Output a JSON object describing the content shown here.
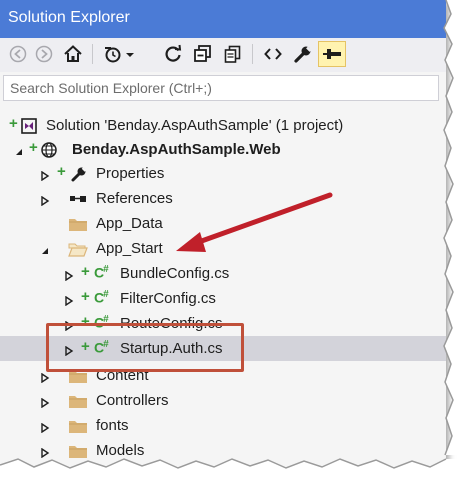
{
  "window": {
    "title": "Solution Explorer"
  },
  "toolbar": {
    "buttons": [
      {
        "icon": "back-icon"
      },
      {
        "icon": "forward-icon"
      },
      {
        "icon": "home-icon"
      },
      {
        "icon": "history-icon"
      },
      {
        "icon": "sync-icon"
      },
      {
        "icon": "collapse-all-icon"
      },
      {
        "icon": "copy-icon"
      },
      {
        "icon": "code-view-icon"
      },
      {
        "icon": "properties-wrench-icon"
      },
      {
        "icon": "pin-icon",
        "active": true
      }
    ]
  },
  "search": {
    "placeholder": "Search Solution Explorer (Ctrl+;)"
  },
  "tree": {
    "items": [
      {
        "label": "Solution 'Benday.AspAuthSample' (1 project)",
        "icon": "solution-icon"
      },
      {
        "label": "Benday.AspAuthSample.Web",
        "icon": "web-project-icon",
        "bold": true
      },
      {
        "label": "Properties",
        "icon": "wrench-icon"
      },
      {
        "label": "References",
        "icon": "references-icon"
      },
      {
        "label": "App_Data",
        "icon": "folder-icon"
      },
      {
        "label": "App_Start",
        "icon": "open-folder-icon"
      },
      {
        "label": "BundleConfig.cs",
        "icon": "csharp-file-icon"
      },
      {
        "label": "FilterConfig.cs",
        "icon": "csharp-file-icon"
      },
      {
        "label": "RouteConfig.cs",
        "icon": "csharp-file-icon"
      },
      {
        "label": "Startup.Auth.cs",
        "icon": "csharp-file-icon",
        "selected": true
      },
      {
        "label": "Content",
        "icon": "folder-icon"
      },
      {
        "label": "Controllers",
        "icon": "folder-icon"
      },
      {
        "label": "fonts",
        "icon": "folder-icon"
      },
      {
        "label": "Models",
        "icon": "folder-icon"
      }
    ]
  },
  "colors": {
    "title_bar": "#4b7bd6",
    "selection": "#d3d3da",
    "annotation_red": "#c0503a",
    "folder": "#dcb67a",
    "csharp_green": "#3a9a3a"
  }
}
